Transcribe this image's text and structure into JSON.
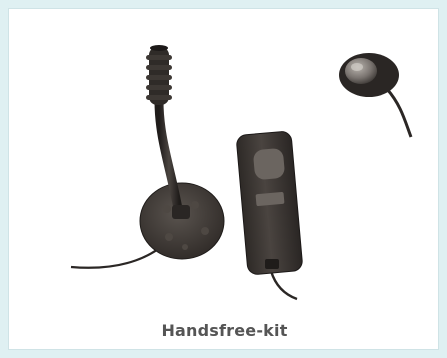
{
  "product": {
    "caption": "Handsfree-kit",
    "image_description_icon": "handsfree-kit-photo",
    "inset_icon": "push-button-detail-photo"
  },
  "colors": {
    "background": "#dff0f2",
    "card": "#ffffff",
    "caption_text": "#555555",
    "device_dark": "#3a3531",
    "device_light": "#5b5550"
  }
}
